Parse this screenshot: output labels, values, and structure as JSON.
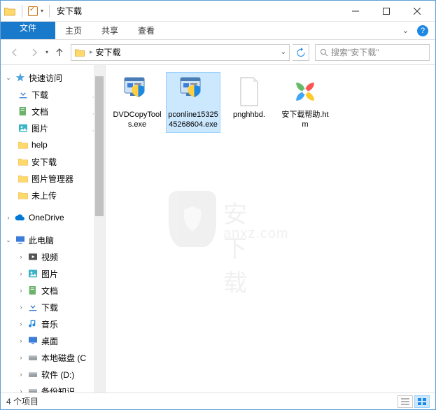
{
  "title": "安下载",
  "ribbon": {
    "file": "文件",
    "home": "主页",
    "share": "共享",
    "view": "查看"
  },
  "nav": {
    "breadcrumb": [
      "安下载"
    ],
    "search_placeholder": "搜索\"安下载\""
  },
  "sidebar": {
    "quick_access": "快速访问",
    "items": [
      {
        "label": "下载",
        "icon": "download",
        "pinned": true
      },
      {
        "label": "文档",
        "icon": "documents",
        "pinned": true
      },
      {
        "label": "图片",
        "icon": "pictures",
        "pinned": true
      },
      {
        "label": "help",
        "icon": "folder",
        "pinned": false
      },
      {
        "label": "安下载",
        "icon": "folder",
        "pinned": false
      },
      {
        "label": "图片管理器",
        "icon": "folder",
        "pinned": false
      },
      {
        "label": "未上传",
        "icon": "folder",
        "pinned": false
      }
    ],
    "onedrive": "OneDrive",
    "this_pc": "此电脑",
    "pc_items": [
      {
        "label": "视频",
        "icon": "videos"
      },
      {
        "label": "图片",
        "icon": "pictures"
      },
      {
        "label": "文档",
        "icon": "documents"
      },
      {
        "label": "下载",
        "icon": "download"
      },
      {
        "label": "音乐",
        "icon": "music"
      },
      {
        "label": "桌面",
        "icon": "desktop"
      },
      {
        "label": "本地磁盘 (C",
        "icon": "drive"
      },
      {
        "label": "软件 (D:)",
        "icon": "drive"
      },
      {
        "label": "备份知识",
        "icon": "drive"
      }
    ]
  },
  "files": [
    {
      "name": "DVDCopyTools.exe",
      "icon": "exe-shield",
      "selected": false
    },
    {
      "name": "pconline1532545268604.exe",
      "icon": "exe-shield",
      "selected": true
    },
    {
      "name": "pnghhbd.",
      "icon": "blank-doc",
      "selected": false
    },
    {
      "name": "安下载帮助.htm",
      "icon": "pinwheel",
      "selected": false
    }
  ],
  "watermark": {
    "line1": "安下载",
    "line2": "anxz.com"
  },
  "status": {
    "text": "4 个项目"
  }
}
